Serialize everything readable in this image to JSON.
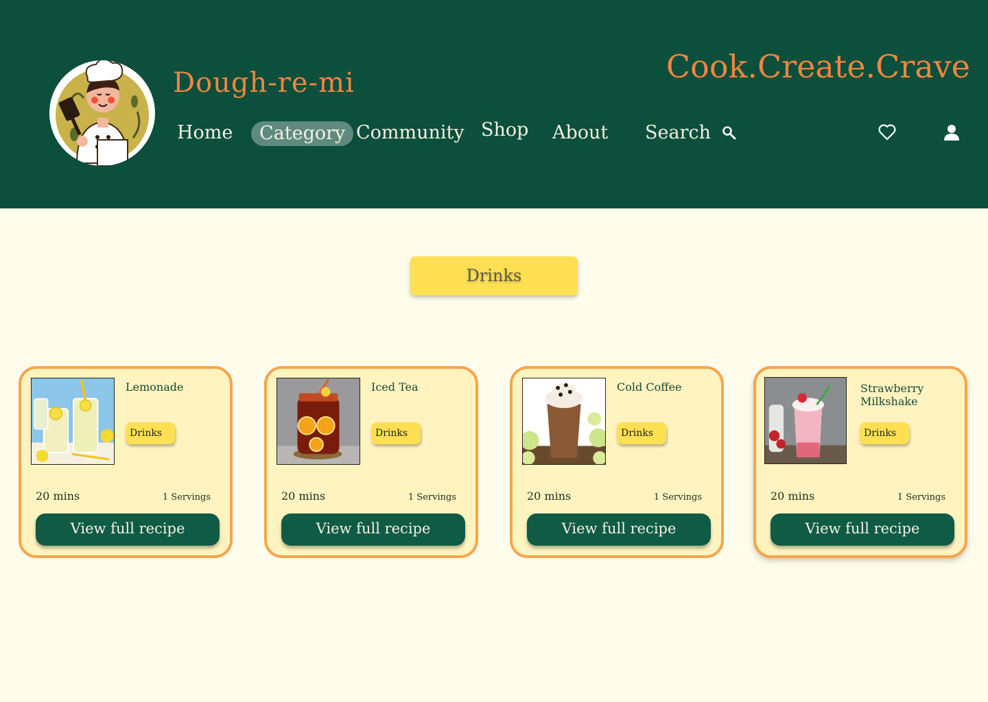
{
  "colors": {
    "header_bg": "#0b4f3c",
    "accent_orange": "#f0863f",
    "page_bg": "#fffcec",
    "pill_yellow": "#ffe053",
    "card_bg": "#fff4bf",
    "card_border": "#f6a54c",
    "button_green": "#0f5b45"
  },
  "header": {
    "brand": "Dough-re-mi",
    "tagline": "Cook.Create.Crave",
    "logo_icon": "chef-logo",
    "nav": [
      {
        "label": "Home"
      },
      {
        "label": "Category",
        "active": true
      },
      {
        "label": "Community"
      },
      {
        "label": "Shop"
      },
      {
        "label": "About"
      },
      {
        "label": "Search"
      }
    ],
    "icons": [
      "search-icon",
      "heart-icon",
      "user-icon"
    ]
  },
  "category": {
    "label": "Drinks"
  },
  "recipes": [
    {
      "title": "Lemonade",
      "tag": "Drinks",
      "time": "20 mins",
      "servings": "1 Servings",
      "button": "View full recipe",
      "image": "lemonade-photo"
    },
    {
      "title": "Iced Tea",
      "tag": "Drinks",
      "time": "20 mins",
      "servings": "1 Servings",
      "button": "View full recipe",
      "image": "iced-tea-photo"
    },
    {
      "title": "Cold Coffee",
      "tag": "Drinks",
      "time": "20 mins",
      "servings": "1 Servings",
      "button": "View full recipe",
      "image": "cold-coffee-photo"
    },
    {
      "title": "Strawberry Milkshake",
      "tag": "Drinks",
      "time": "20 mins",
      "servings": "1 Servings",
      "button": "View full recipe",
      "image": "strawberry-milkshake-photo"
    }
  ]
}
